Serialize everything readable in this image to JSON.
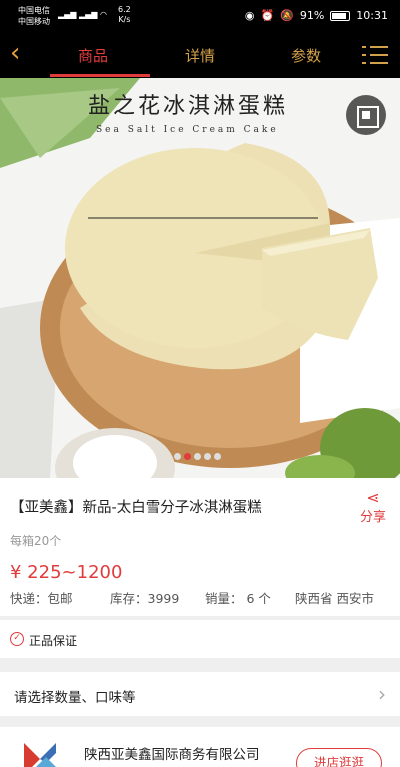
{
  "status_bar": {
    "carrier1": "中国电信",
    "carrier2": "中国移动",
    "net_speed_value": "6.2",
    "net_speed_unit": "K/s",
    "battery": "91%",
    "time": "10:31"
  },
  "nav": {
    "tabs": [
      {
        "label": "商品",
        "active": true
      },
      {
        "label": "详情",
        "active": false
      },
      {
        "label": "参数",
        "active": false
      }
    ]
  },
  "hero": {
    "title": "盐之花冰淇淋蛋糕",
    "subtitle": "Sea Salt Ice Cream Cake",
    "slide_count": 5,
    "active_slide": 1
  },
  "product": {
    "name": "【亚美鑫】新品-太白雪分子冰淇淋蛋糕",
    "share_label": "分享",
    "pack": "每箱20个",
    "price": "¥ 225~1200",
    "shipping": "快递：包邮",
    "stock": "库存：3999",
    "sales": "销量： 6 个",
    "location": "陕西省 西安市"
  },
  "guarantee": {
    "label": "正品保证"
  },
  "options": {
    "label": "请选择数量、口味等"
  },
  "shop": {
    "name": "陕西亚美鑫国际商务有限公司",
    "visit_label": "进店逛逛"
  },
  "colors": {
    "accent": "#e03c3c",
    "tab_gold": "#d4a14b"
  }
}
